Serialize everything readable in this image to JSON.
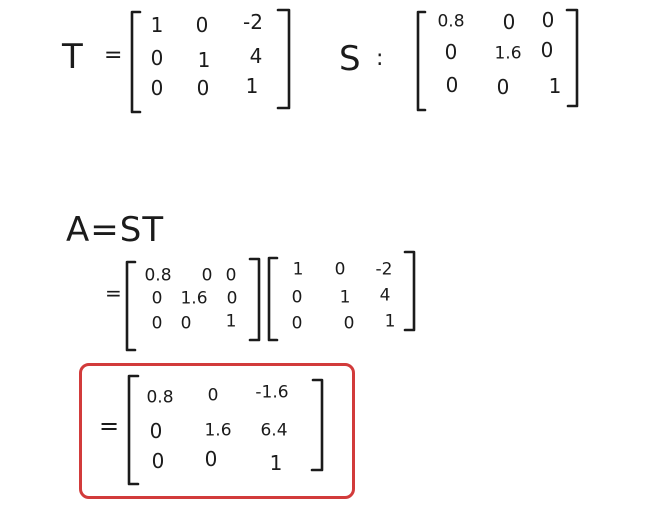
{
  "T": {
    "label": "T",
    "eq": "=",
    "rows": [
      [
        "1",
        "0",
        "-2"
      ],
      [
        "0",
        "1",
        "4"
      ],
      [
        "0",
        "0",
        "1"
      ]
    ]
  },
  "S": {
    "label": "S",
    "eq": ":",
    "rows": [
      [
        "0.8",
        "0",
        "0"
      ],
      [
        "0",
        "1.6",
        "0"
      ],
      [
        "0",
        "0",
        "1"
      ]
    ]
  },
  "A": {
    "def": "A=ST",
    "eq1": "=",
    "left_rows": [
      [
        "0.8",
        "0",
        "0"
      ],
      [
        "0",
        "1.6",
        "0"
      ],
      [
        "0",
        "0",
        "1"
      ]
    ],
    "right_rows": [
      [
        "1",
        "0",
        "-2"
      ],
      [
        "0",
        "1",
        "4"
      ],
      [
        "0",
        "0",
        "1"
      ]
    ],
    "eq2": "=",
    "result_rows": [
      [
        "0.8",
        "0",
        "-1.6"
      ],
      [
        "0",
        "1.6",
        "6.4"
      ],
      [
        "0",
        "0",
        "1"
      ]
    ]
  },
  "colors": {
    "ink": "#1b1b1b",
    "highlight_box": "#d23b3b"
  }
}
